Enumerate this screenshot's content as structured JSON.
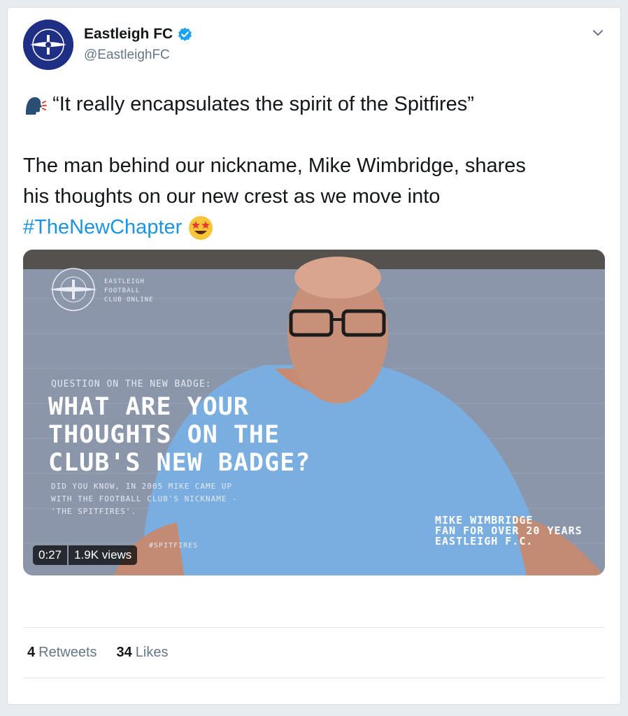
{
  "account": {
    "display_name": "Eastleigh FC",
    "handle": "@EastleighFC",
    "verified": true,
    "avatar_text": "EASTLEIGH FOOTBALL CLUB",
    "avatar_color": "#1f2f86"
  },
  "tweet": {
    "line1": "“It really encapsulates the spirit of the Spitfires”",
    "line2": "The man behind our nickname, Mike Wimbridge, shares",
    "line3": "his thoughts on our new crest as we move into",
    "hashtag": "#TheNewChapter",
    "leading_emoji": "speaking-head-icon",
    "trailing_emoji": "star-struck-icon"
  },
  "video": {
    "duration": "0:27",
    "views": "1.9K views",
    "overlay": {
      "brand_lines": [
        "EASTLEIGH",
        "FOOTBALL",
        "CLUB ONLINE"
      ],
      "question": "QUESTION ON THE NEW BADGE:",
      "headline_lines": [
        "WHAT ARE YOUR",
        "THOUGHTS ON THE",
        "CLUB'S NEW BADGE?"
      ],
      "fact_lines": [
        "DID YOU KNOW, IN 2005 MIKE CAME UP",
        "WITH THE FOOTBALL CLUB'S NICKNAME -",
        "'THE SPITFIRES'."
      ],
      "hashtag": "#SPITFIRES",
      "caption_lines": [
        "MIKE WIMBRIDGE",
        "FAN FOR OVER 20 YEARS",
        "EASTLEIGH F.C."
      ]
    }
  },
  "stats": {
    "retweets_count": "4",
    "retweets_label": "Retweets",
    "likes_count": "34",
    "likes_label": "Likes"
  },
  "colors": {
    "link": "#1b95e0",
    "text": "#14171a",
    "secondary": "#657786",
    "verified": "#1da1f2"
  }
}
